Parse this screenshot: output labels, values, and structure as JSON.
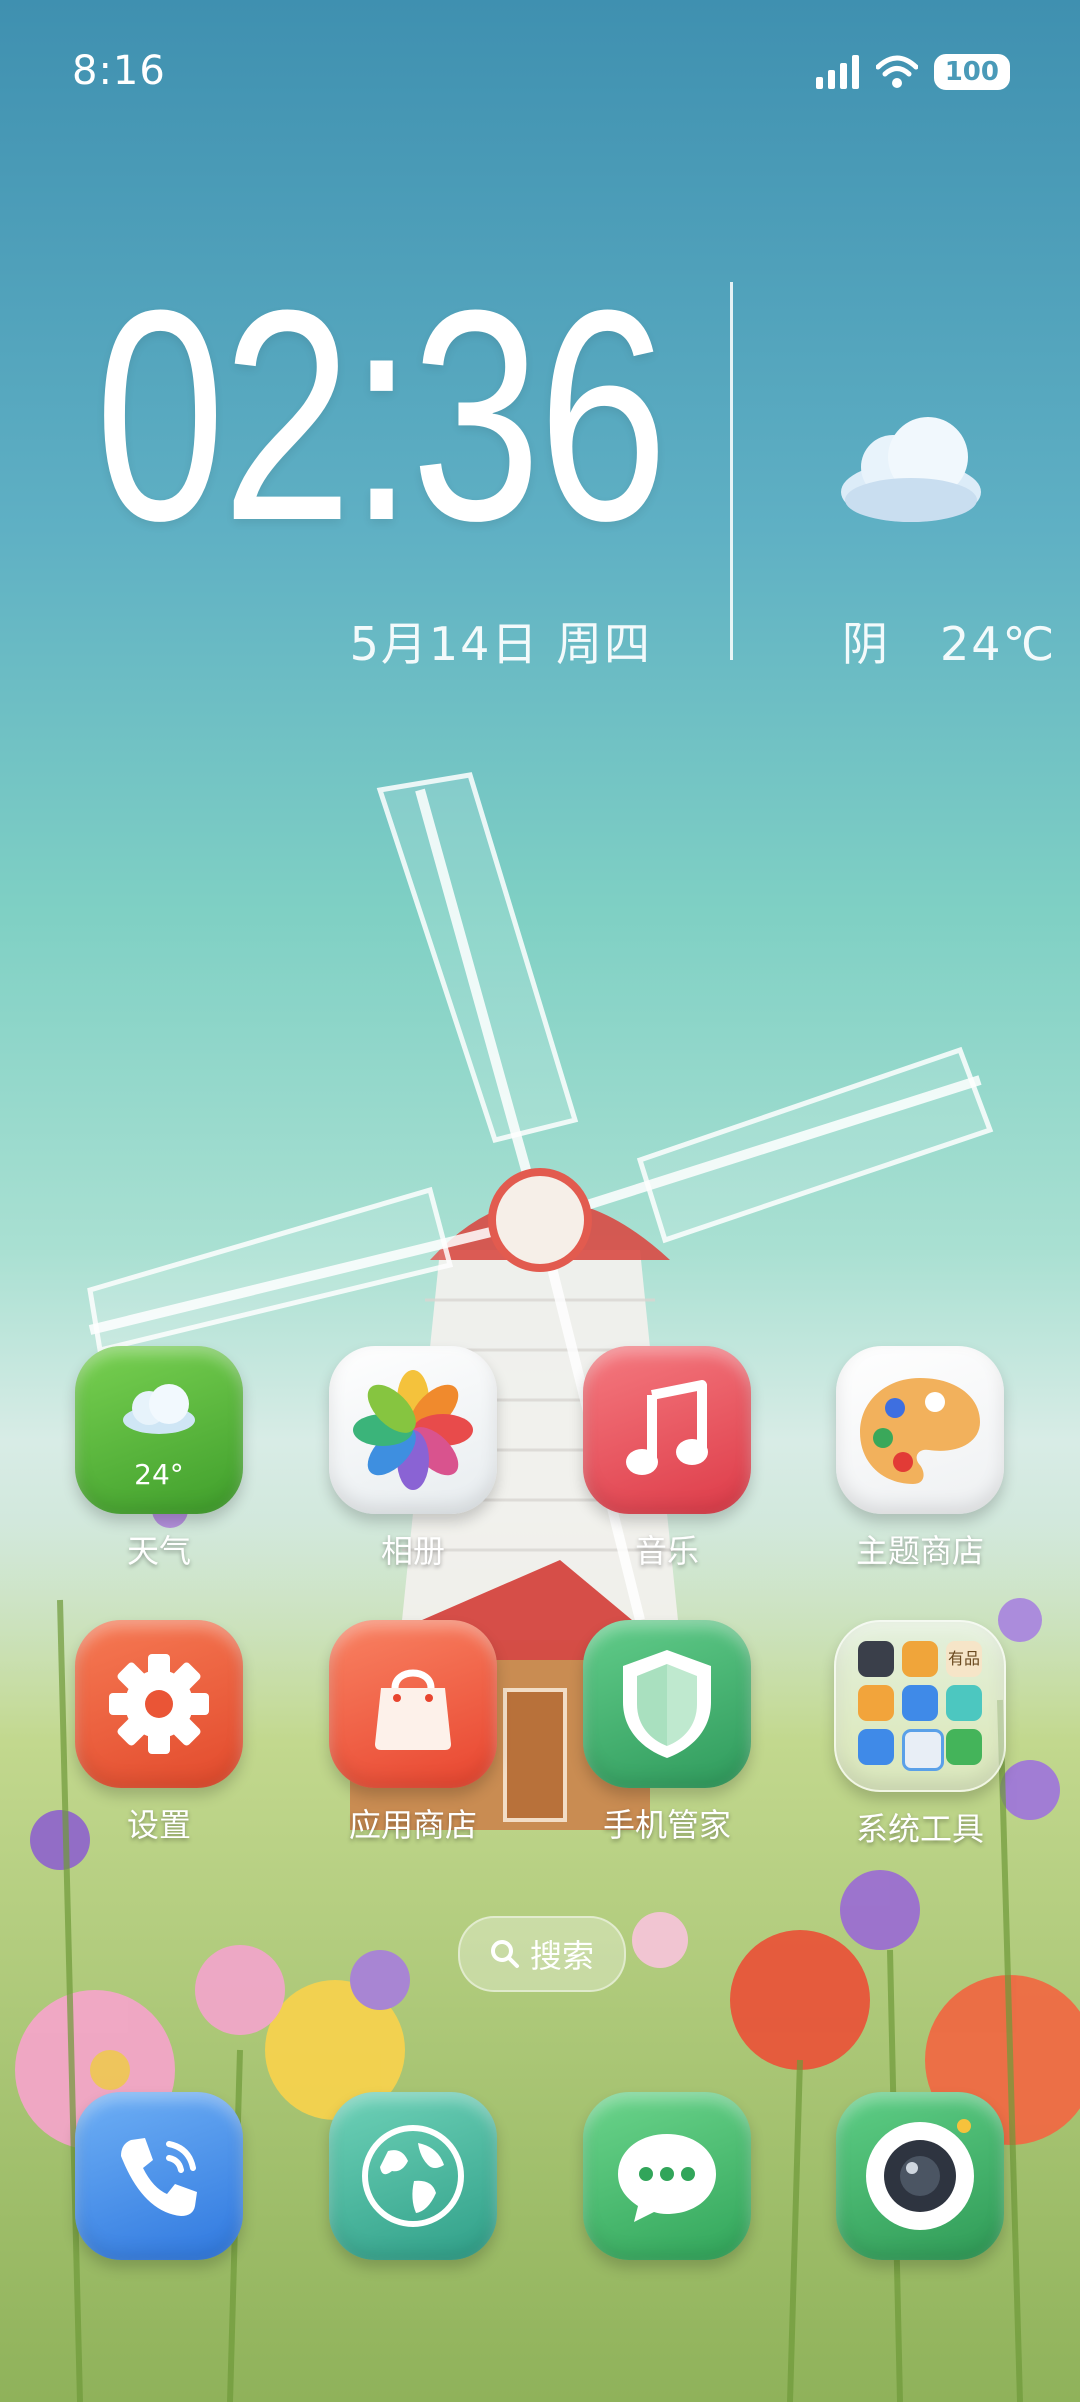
{
  "status_bar": {
    "time": "8:16",
    "battery": "100"
  },
  "clock_widget": {
    "time": "02:36",
    "date": "5月14日 周四",
    "weather_condition": "阴",
    "temperature": "24℃"
  },
  "apps": {
    "weather": {
      "label": "天气",
      "icon_temp": "24°"
    },
    "gallery": {
      "label": "相册"
    },
    "music": {
      "label": "音乐"
    },
    "theme_store": {
      "label": "主题商店"
    },
    "settings": {
      "label": "设置"
    },
    "app_store": {
      "label": "应用商店"
    },
    "phone_manager": {
      "label": "手机管家"
    },
    "system_tools": {
      "label": "系统工具",
      "folder_badge": "有品"
    }
  },
  "search": {
    "label": "搜索"
  },
  "dock": [
    "phone-icon",
    "browser-icon",
    "messages-icon",
    "camera-icon"
  ],
  "colors": {
    "weather_green": "#55b53a",
    "music_red": "#e8505b",
    "settings_orange": "#ef5a3c",
    "store_orange": "#f15f45",
    "shield_green": "#3fae6a",
    "phone_blue": "#3a86e8"
  }
}
